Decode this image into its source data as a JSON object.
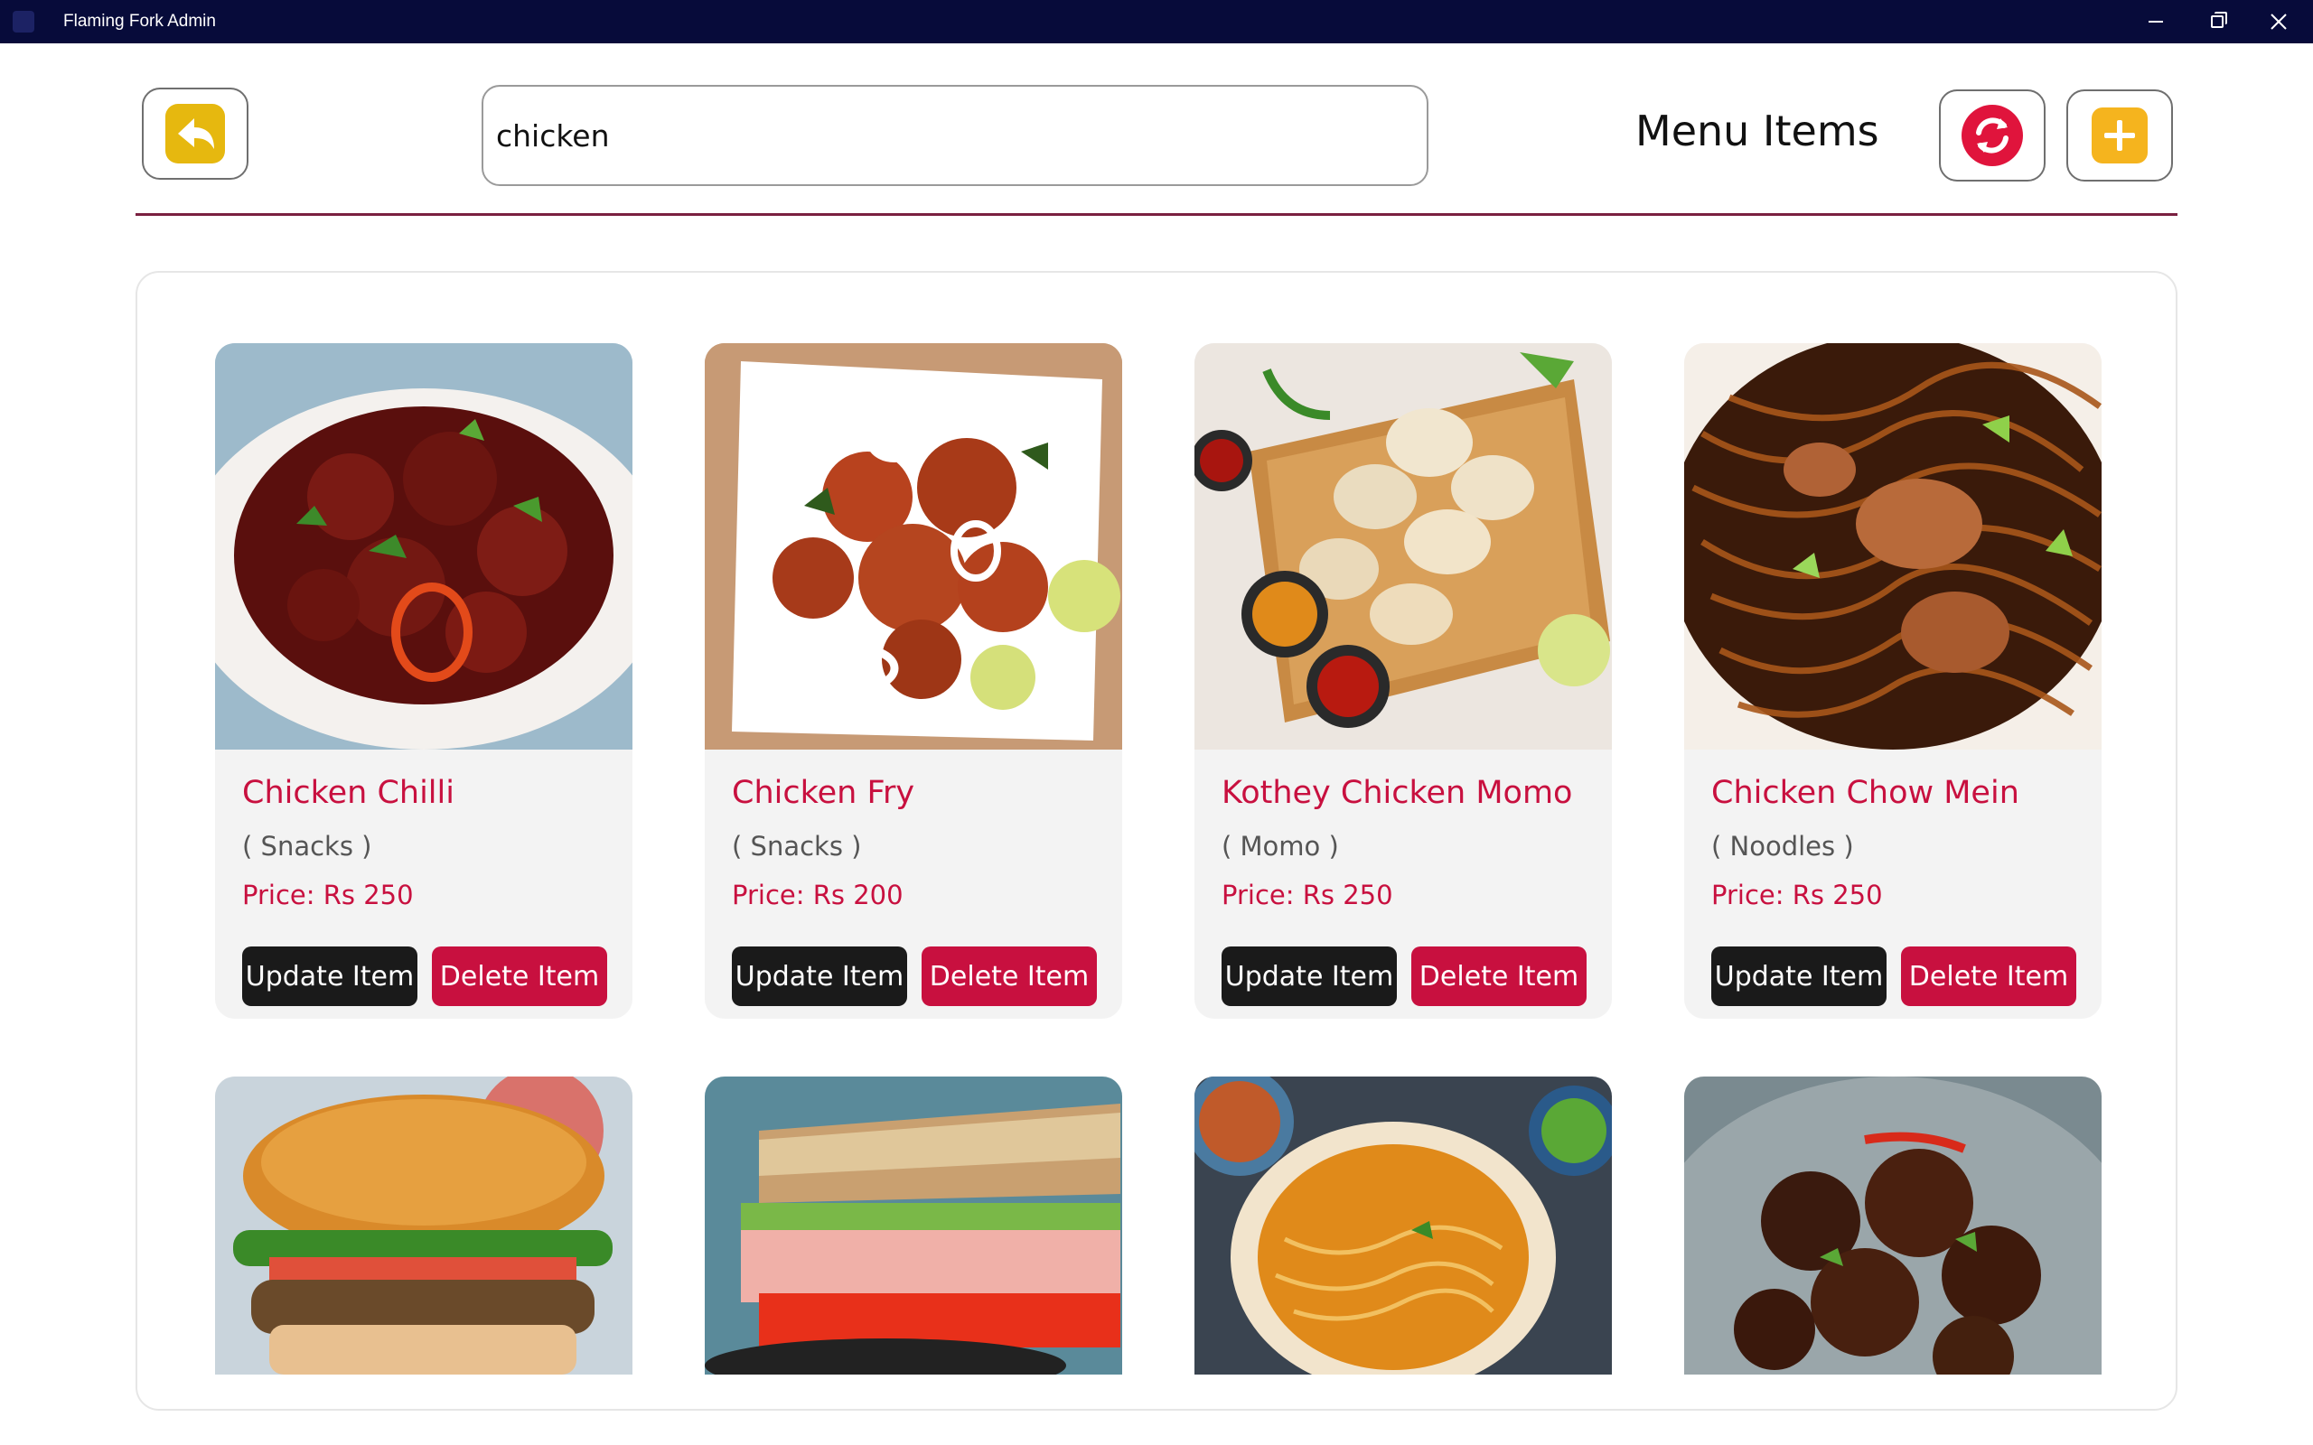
{
  "window": {
    "title": "Flaming Fork Admin",
    "controls": [
      "minimize-icon",
      "restore-icon",
      "close-icon"
    ]
  },
  "header": {
    "back_icon": "back-arrow-icon",
    "search": {
      "value": "chicken",
      "placeholder": ""
    },
    "title": "Menu Items",
    "refresh_icon": "refresh-icon",
    "add_icon": "plus-icon"
  },
  "colors": {
    "accent": "#c8103f",
    "titlebar": "#070b3a",
    "divider": "#7a2040",
    "back_button": "#e6b80f",
    "refresh_button": "#e0143c",
    "add_button": "#f5b41e"
  },
  "items": [
    {
      "name": "Chicken Chilli",
      "category": "( Snacks )",
      "price": "Price: Rs 250",
      "update_label": "Update Item",
      "delete_label": "Delete Item"
    },
    {
      "name": "Chicken Fry",
      "category": "( Snacks )",
      "price": "Price: Rs 200",
      "update_label": "Update Item",
      "delete_label": "Delete Item"
    },
    {
      "name": "Kothey Chicken Momo",
      "category": "( Momo )",
      "price": "Price: Rs 250",
      "update_label": "Update Item",
      "delete_label": "Delete Item"
    },
    {
      "name": "Chicken Chow Mein",
      "category": "( Noodles )",
      "price": "Price: Rs 250",
      "update_label": "Update Item",
      "delete_label": "Delete Item"
    }
  ],
  "lower_items": [
    {
      "image": "chicken-burger-image"
    },
    {
      "image": "chicken-sandwich-image"
    },
    {
      "image": "chicken-thukpa-image"
    },
    {
      "image": "chicken-sekuwa-image"
    }
  ]
}
